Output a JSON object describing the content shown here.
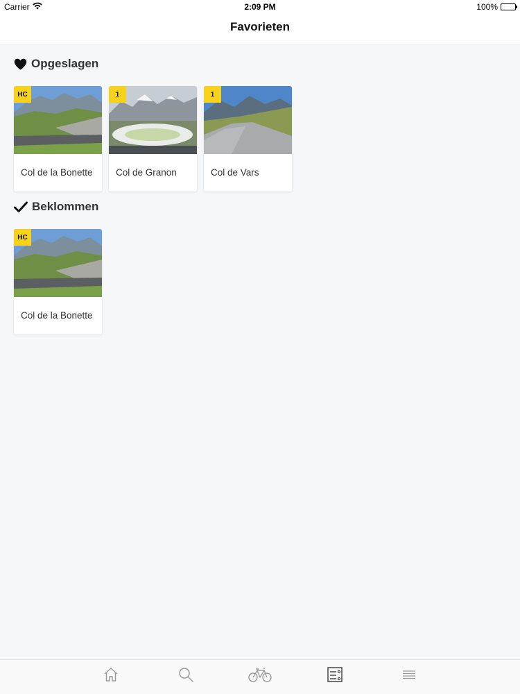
{
  "status_bar": {
    "carrier": "Carrier",
    "time": "2:09 PM",
    "battery": "100%",
    "battery_level": 1.0
  },
  "nav": {
    "title": "Favorieten"
  },
  "sections": [
    {
      "title": "Opgeslagen",
      "icon": "heart-icon",
      "cards": [
        {
          "badge": "HC",
          "name": "Col de la Bonette"
        },
        {
          "badge": "1",
          "name": "Col de Granon"
        },
        {
          "badge": "1",
          "name": "Col de Vars"
        }
      ]
    },
    {
      "title": "Beklommen",
      "icon": "checkmark-icon",
      "cards": [
        {
          "badge": "HC",
          "name": "Col de la Bonette"
        }
      ]
    }
  ],
  "tab_bar": {
    "items": [
      {
        "icon": "home-icon"
      },
      {
        "icon": "search-icon"
      },
      {
        "icon": "bicycle-icon"
      },
      {
        "icon": "favorites-list-icon",
        "active": true
      },
      {
        "icon": "menu-icon"
      }
    ]
  },
  "colors": {
    "badge": "#f6d21a",
    "background": "#f6f7f9",
    "tab_icon": "#9a9a9a",
    "tab_icon_active": "#444444"
  }
}
